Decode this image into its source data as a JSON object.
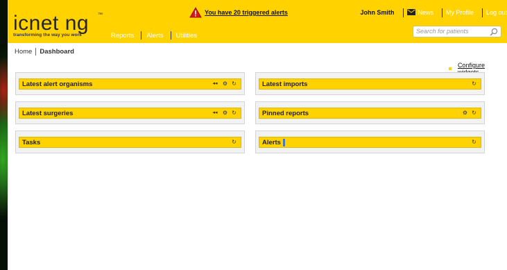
{
  "app": {
    "logo_word": "icnet ng",
    "logo_tm": "™",
    "logo_tagline": "transforming the way you work"
  },
  "alert_banner": {
    "text": "You have 20 triggered alerts"
  },
  "user_bar": {
    "user_name": "John Smith",
    "news": "News",
    "profile": "My Profile",
    "logout": "Log out"
  },
  "search": {
    "placeholder": "Search for patients"
  },
  "nav": {
    "items": [
      {
        "label": "Reports"
      },
      {
        "label": "Alerts"
      },
      {
        "label": "Utilities"
      }
    ]
  },
  "breadcrumb": {
    "home": "Home",
    "current": "Dashboard"
  },
  "configure_widgets": "Configure widgets",
  "widgets": {
    "left": [
      {
        "title": "Latest alert organisms",
        "tools": [
          "prev",
          "settings",
          "refresh"
        ]
      },
      {
        "title": "Latest surgeries",
        "tools": [
          "prev",
          "settings",
          "refresh"
        ]
      },
      {
        "title": "Tasks",
        "tools": [
          "refresh"
        ]
      }
    ],
    "right": [
      {
        "title": "Latest imports",
        "tools": [
          "refresh"
        ]
      },
      {
        "title": "Pinned reports",
        "tools": [
          "settings",
          "refresh"
        ]
      },
      {
        "title": "Alerts",
        "tools": [
          "refresh"
        ]
      }
    ]
  },
  "icons": {
    "prev": "◂◂",
    "settings": "⚙",
    "refresh": "↻"
  },
  "colors": {
    "brand_yellow": "#ffd200",
    "header_text_light": "#ffffff",
    "panel_bg": "#f2f2f2"
  }
}
